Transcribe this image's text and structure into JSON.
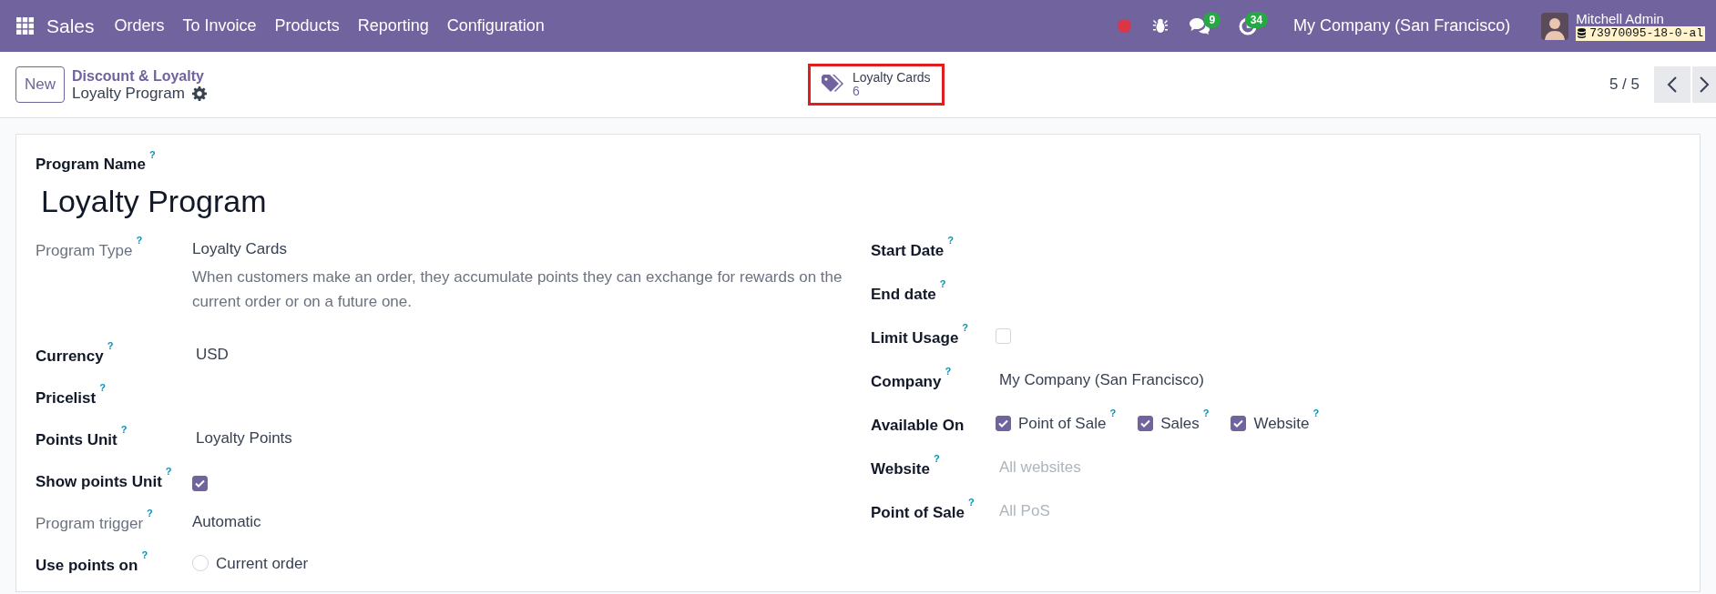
{
  "navbar": {
    "app": "Sales",
    "menus": [
      "Orders",
      "To Invoice",
      "Products",
      "Reporting",
      "Configuration"
    ],
    "chat_badge": "9",
    "activity_badge": "34",
    "company": "My Company (San Francisco)",
    "user": "Mitchell Admin",
    "database": "73970095-18-0-al"
  },
  "control_panel": {
    "new_button": "New",
    "breadcrumb": "Discount & Loyalty",
    "record": "Loyalty Program",
    "smart_button": {
      "label": "Loyalty Cards",
      "count": "6",
      "highlighted": true
    },
    "pager": "5 / 5"
  },
  "form": {
    "name_label": "Program Name",
    "name_help": "?",
    "name": "Loyalty Program",
    "left_fields": [
      {
        "label": "Program Type",
        "help": "?",
        "readonly": true,
        "kind": "text",
        "value": "Loyalty Cards",
        "description": "When customers make an order, they accumulate points they can exchange for rewards on the current order or on a future one."
      },
      {
        "label": "Currency",
        "help": "?",
        "readonly": false,
        "kind": "text",
        "value": "USD"
      },
      {
        "label": "Pricelist",
        "help": "?",
        "readonly": false,
        "kind": "empty"
      },
      {
        "label": "Points Unit",
        "help": "?",
        "readonly": false,
        "kind": "text",
        "value": "Loyalty Points"
      },
      {
        "label": "Show points Unit",
        "help": "?",
        "readonly": false,
        "kind": "checkbox",
        "checked": true
      },
      {
        "label": "Program trigger",
        "help": "?",
        "readonly": true,
        "kind": "text",
        "value": "Automatic"
      },
      {
        "label": "Use points on",
        "help": "?",
        "readonly": false,
        "kind": "radio",
        "options": [
          {
            "label": "Current order",
            "selected": false
          }
        ]
      }
    ],
    "right_fields": [
      {
        "label": "Start Date",
        "help": "?",
        "readonly": false,
        "kind": "empty"
      },
      {
        "label": "End date",
        "help": "?",
        "readonly": false,
        "kind": "empty"
      },
      {
        "label": "Limit Usage",
        "help": "?",
        "readonly": false,
        "kind": "checkbox",
        "checked": false
      },
      {
        "label": "Company",
        "help": "?",
        "readonly": false,
        "kind": "text",
        "value": "My Company (San Francisco)"
      },
      {
        "label": "Available On",
        "readonly": false,
        "kind": "checkboxes",
        "options": [
          {
            "label": "Point of Sale",
            "help": "?",
            "checked": true
          },
          {
            "label": "Sales",
            "help": "?",
            "checked": true
          },
          {
            "label": "Website",
            "help": "?",
            "checked": true
          }
        ]
      },
      {
        "label": "Website",
        "help": "?",
        "readonly": false,
        "kind": "placeholder",
        "placeholder": "All websites"
      },
      {
        "label": "Point of Sale",
        "help": "?",
        "readonly": false,
        "kind": "placeholder",
        "placeholder": "All PoS"
      }
    ]
  }
}
